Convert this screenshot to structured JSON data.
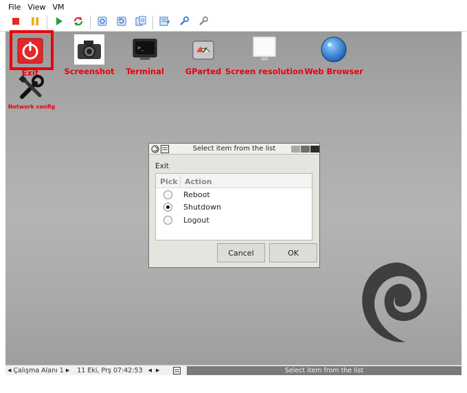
{
  "menu": [
    "File",
    "View",
    "VM"
  ],
  "toolbar": {
    "buttons": [
      {
        "name": "stop-button",
        "icon": "stop-icon",
        "color": "#e52b1d"
      },
      {
        "name": "pause-button",
        "icon": "pause-icon",
        "color": "#f2a900"
      },
      {
        "name": "play-button",
        "icon": "play-icon",
        "color": "#1ea335"
      },
      {
        "name": "restart-button",
        "icon": "refresh-icon",
        "color": "#d33"
      },
      {
        "name": "snapshot-button",
        "icon": "snapshot-icon",
        "color": "#3a7bd5"
      },
      {
        "name": "revert-snapshot-button",
        "icon": "revert-icon",
        "color": "#3a7bd5"
      },
      {
        "name": "manage-snapshots-button",
        "icon": "snapshot-manager-icon",
        "color": "#3a7bd5"
      },
      {
        "name": "send-keys-button",
        "icon": "keyboard-icon",
        "color": "#3a7bd5"
      },
      {
        "name": "settings-button",
        "icon": "settings-icon",
        "color": "#3a7bd5"
      },
      {
        "name": "tools-button",
        "icon": "tools-icon",
        "color": "#888888"
      }
    ]
  },
  "desktop": {
    "icons": [
      {
        "label": "Exit",
        "icon": "power-icon"
      },
      {
        "label": "Screenshot",
        "icon": "camera-icon"
      },
      {
        "label": "Terminal",
        "icon": "terminal-icon"
      },
      {
        "label": "GParted",
        "icon": "disk-icon"
      },
      {
        "label": "Screen resolution",
        "icon": "monitor-icon"
      },
      {
        "label": "Web Browser",
        "icon": "globe-icon"
      },
      {
        "label": "Network config",
        "icon": "wrench-icon"
      }
    ],
    "label_color": "#e8000b"
  },
  "dialog": {
    "title": "Select item from the list",
    "prompt": "Exit",
    "columns": [
      "Pick",
      "Action"
    ],
    "rows": [
      {
        "action": "Reboot",
        "selected": false
      },
      {
        "action": "Shutdown",
        "selected": true
      },
      {
        "action": "Logout",
        "selected": false
      }
    ],
    "cancel_label": "Cancel",
    "ok_label": "OK"
  },
  "taskbar": {
    "workspace": "Çalışma Alanı 1",
    "clock": "11 Eki, Prş 07:42:53",
    "active_window": "Select item from the list"
  },
  "highlight_color": "#e8000b"
}
